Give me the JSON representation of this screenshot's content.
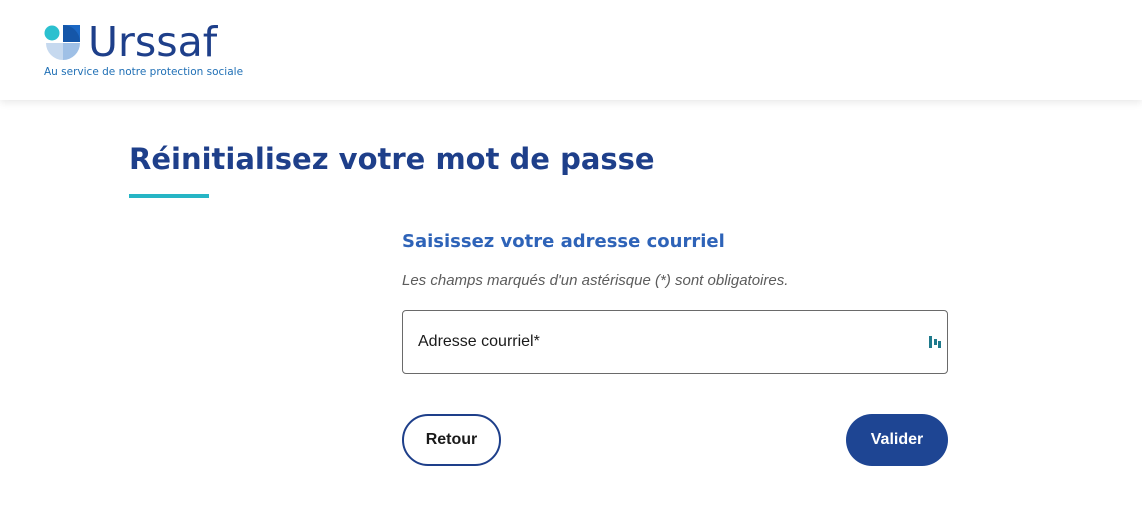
{
  "header": {
    "logo": {
      "wordmark": "Urssaf",
      "tagline": "Au service de notre protection sociale"
    }
  },
  "main": {
    "title": "Réinitialisez votre mot de passe",
    "form": {
      "heading": "Saisissez votre adresse courriel",
      "required_note": "Les champs marqués d'un astérisque (*) sont obligatoires.",
      "email_field": {
        "label": "Adresse courriel*",
        "value": ""
      },
      "buttons": {
        "back_label": "Retour",
        "submit_label": "Valider"
      }
    }
  },
  "colors": {
    "brand_navy": "#1e3f8a",
    "heading_blue": "#2e63b8",
    "accent_teal": "#26b5c5",
    "button_navy": "#1e4593"
  },
  "icons": {
    "field_icon": "password-manager-icon"
  }
}
